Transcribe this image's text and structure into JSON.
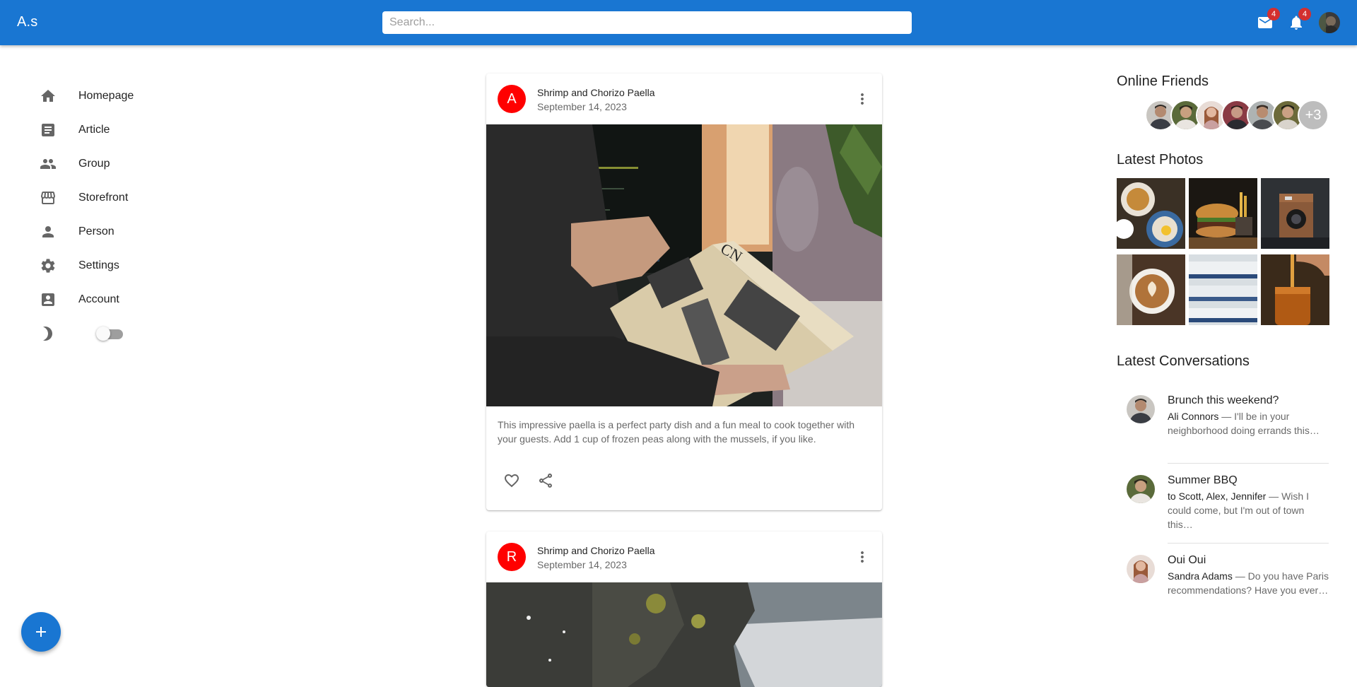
{
  "app": {
    "brand": "A.s"
  },
  "search": {
    "placeholder": "Search..."
  },
  "appbar": {
    "mail_badge": "4",
    "notifications_badge": "4"
  },
  "sidebar": {
    "items": [
      {
        "label": "Homepage",
        "icon": "home-icon"
      },
      {
        "label": "Article",
        "icon": "article-icon"
      },
      {
        "label": "Group",
        "icon": "group-icon"
      },
      {
        "label": "Storefront",
        "icon": "storefront-icon"
      },
      {
        "label": "Person",
        "icon": "person-icon"
      },
      {
        "label": "Settings",
        "icon": "settings-icon"
      },
      {
        "label": "Account",
        "icon": "account-box-icon"
      }
    ],
    "theme_toggle": {
      "icon": "dark-mode-icon",
      "checked": false
    }
  },
  "fab": {
    "icon": "add-icon",
    "label": "+"
  },
  "feed": {
    "posts": [
      {
        "avatar_letter": "A",
        "title": "Shrimp and Chorizo Paella",
        "date": "September 14, 2023",
        "text": "This impressive paella is a perfect party dish and a fun meal to cook together with your guests. Add 1 cup of frozen peas along with the mussels, if you like."
      },
      {
        "avatar_letter": "R",
        "title": "Shrimp and Chorizo Paella",
        "date": "September 14, 2023"
      }
    ]
  },
  "right": {
    "online_friends_title": "Online Friends",
    "friends_more": "+3",
    "latest_photos_title": "Latest Photos",
    "latest_conversations_title": "Latest Conversations",
    "conversations": [
      {
        "title": "Brunch this weekend?",
        "who": "Ali Connors",
        "snippet": " — I'll be in your neighborhood doing errands this…"
      },
      {
        "title": "Summer BBQ",
        "who": "to Scott, Alex, Jennifer",
        "snippet": " — Wish I could come, but I'm out of town this…"
      },
      {
        "title": "Oui Oui",
        "who": "Sandra Adams",
        "snippet": " — Do you have Paris recommendations? Have you ever…"
      }
    ]
  },
  "colors": {
    "primary": "#1976d2",
    "avatar_red": "#ff0000",
    "badge": "#d32f2f"
  }
}
